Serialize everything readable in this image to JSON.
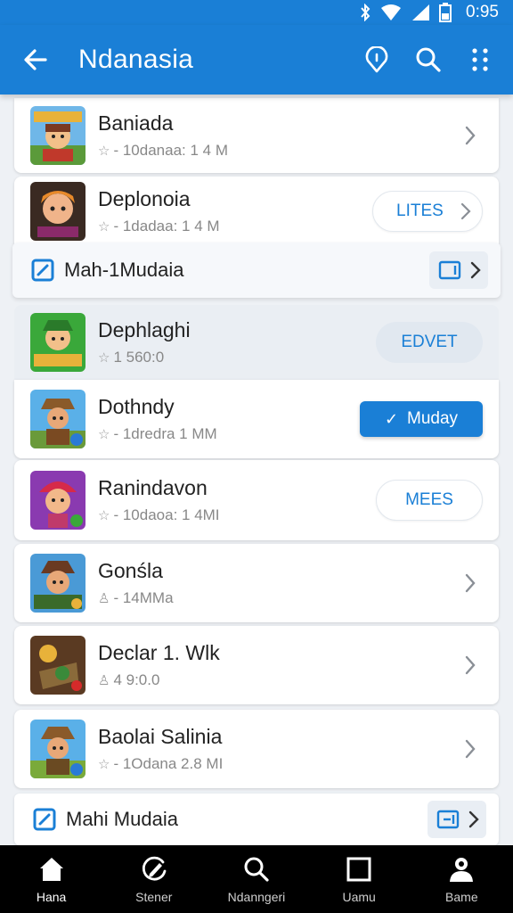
{
  "status_bar": {
    "time": "0:95"
  },
  "app_bar": {
    "title": "Ndanasia"
  },
  "items": [
    {
      "name": "Baniada",
      "meta": "- 10danaa: 1 4 M"
    },
    {
      "name": "Deplonoia",
      "meta": "- 1dadaa: 1 4 M",
      "action_label": "LITES"
    },
    {
      "name": "Dephlaghi",
      "meta": "1 560:0",
      "action_label": "EDVET"
    },
    {
      "name": "Dothndy",
      "meta": "- 1dredra 1 MM",
      "action_label": "Muday"
    },
    {
      "name": "Ranindavon",
      "meta": "- 10daoa: 1 4MI",
      "action_label": "MEES"
    },
    {
      "name": "Gonśla",
      "meta": "- 14MMa"
    },
    {
      "name": "Declar 1. Wlk",
      "meta": "4 9:0.0"
    },
    {
      "name": "Baolai Salinia",
      "meta": "- 1Odana 2.8 MI"
    }
  ],
  "banners": [
    {
      "text": "Mah-1Mudaia"
    },
    {
      "text": "Mahi Mudaia"
    }
  ],
  "bottom_nav": [
    {
      "label": "Hana",
      "icon": "home-icon"
    },
    {
      "label": "Stener",
      "icon": "edit-icon"
    },
    {
      "label": "Ndanngeri",
      "icon": "search-icon"
    },
    {
      "label": "Uamu",
      "icon": "square-icon"
    },
    {
      "label": "Bame",
      "icon": "person-icon"
    }
  ],
  "colors": {
    "primary": "#1a7fd6",
    "background": "#eef1f5",
    "nav_bg": "#000000"
  }
}
